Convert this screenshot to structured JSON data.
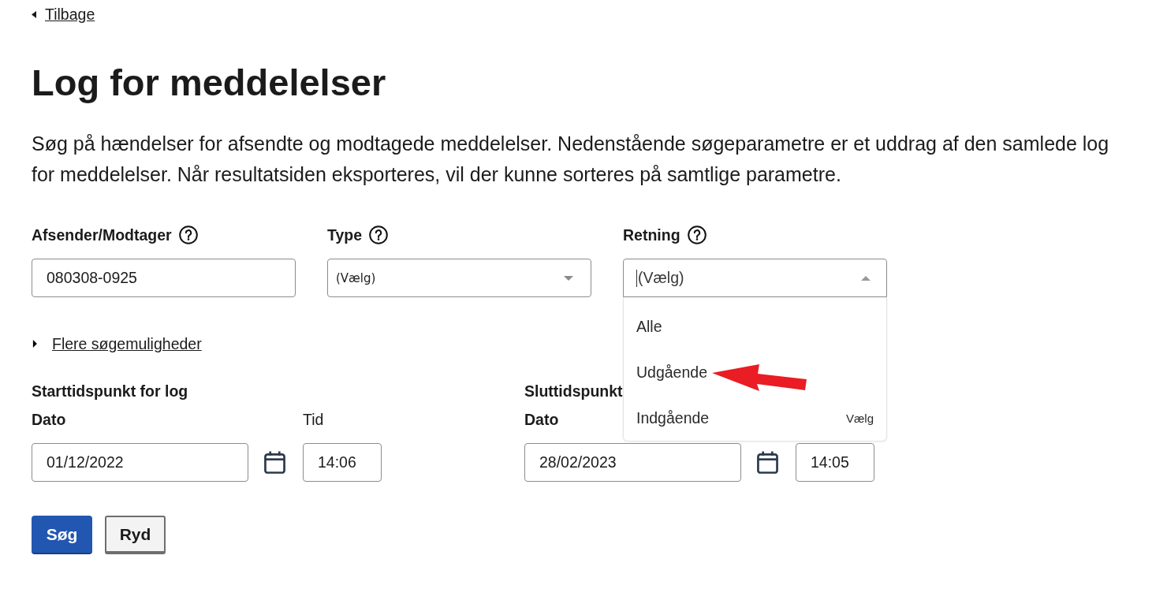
{
  "back_link": {
    "label": "Tilbage"
  },
  "title": "Log for meddelelser",
  "intro": "Søg på hændelser for afsendte og modtagede meddelelser. Nedenstående søgeparametre er et uddrag af den samlede log for meddelelser. Når resultatsiden eksporteres, vil der kunne sorteres på samtlige parametre.",
  "fields": [
    {
      "kind": "text",
      "label": "Afsender/Modtager",
      "value": "080308-0925"
    },
    {
      "kind": "select",
      "label": "Type",
      "value": "(Vælg)",
      "open": false
    },
    {
      "kind": "combobox",
      "label": "Retning",
      "placeholder": "(Vælg)",
      "open": true,
      "options": [
        {
          "label": "Alle",
          "arrow": false
        },
        {
          "label": "Udgående",
          "arrow": true
        },
        {
          "label": "Indgående",
          "arrow": false,
          "hint": "Vælg"
        }
      ]
    }
  ],
  "more_options": {
    "label": "Flere søgemuligheder",
    "expanded": false
  },
  "periods": [
    {
      "title": "Starttidspunkt for log",
      "date_label": "Dato",
      "date": "01/12/2022",
      "time_label": "Tid",
      "time": "14:06"
    },
    {
      "title": "Sluttidspunkt",
      "date_label": "Dato",
      "date": "28/02/2023",
      "time": "14:05"
    }
  ],
  "buttons": [
    {
      "label": "Søg",
      "kind": "primary"
    },
    {
      "label": "Ryd",
      "kind": "secondary"
    }
  ]
}
